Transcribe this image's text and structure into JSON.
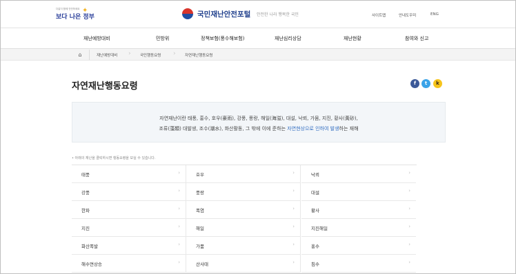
{
  "header": {
    "gov_logo_sub": "다같이 함께 안전하세요",
    "gov_logo_main": "보다 나은 정부",
    "portal_name": "국민재난안전포털",
    "slogan": "안전한 나라 행복한 국민",
    "util": [
      "사이트맵",
      "안내도우미",
      "ENG"
    ]
  },
  "gnb": [
    "재난예방대비",
    "민방위",
    "정책보험(풍수해보험)",
    "재난심리상담",
    "재난현황",
    "참여와 신고"
  ],
  "breadcrumb": [
    "재난예방대비",
    "국민행동요령",
    "자연재난행동요령"
  ],
  "page": {
    "title": "자연재난행동요령",
    "share": [
      "f",
      "t",
      "k"
    ]
  },
  "info": {
    "line1": "자연재난이란 태풍, 홍수, 호우(豪雨), 강풍, 풍랑, 해일(海溢), 대설, 낙뢰, 가뭄, 지진, 황사(黃砂),",
    "line2_pre": "조류(藻類) 대발생, 조수(潮水), 화산활동, 그 밖에 이에 준하는 ",
    "line2_hl": "자연현상으로 인하여 발생",
    "line2_post": "하는 재해"
  },
  "note": "• 아래의 재난을 클릭하시면 행동요령을 보실 수 있습니다.",
  "disasters": [
    "태풍",
    "호우",
    "낙뢰",
    "강풍",
    "풍랑",
    "대설",
    "한파",
    "폭염",
    "황사",
    "지진",
    "해일",
    "지진해일",
    "화산폭발",
    "가뭄",
    "홍수",
    "해수면상승",
    "산사태",
    "침수"
  ],
  "arrow": "›",
  "colors": {
    "accent": "#2f6bc0",
    "info_bg": "#f3f6f9",
    "breadcrumb_bg": "#f4f4f4"
  },
  "icons": {
    "home": "home-icon",
    "facebook": "facebook-icon",
    "twitter": "twitter-icon",
    "kakaostory": "kakaostory-icon"
  }
}
